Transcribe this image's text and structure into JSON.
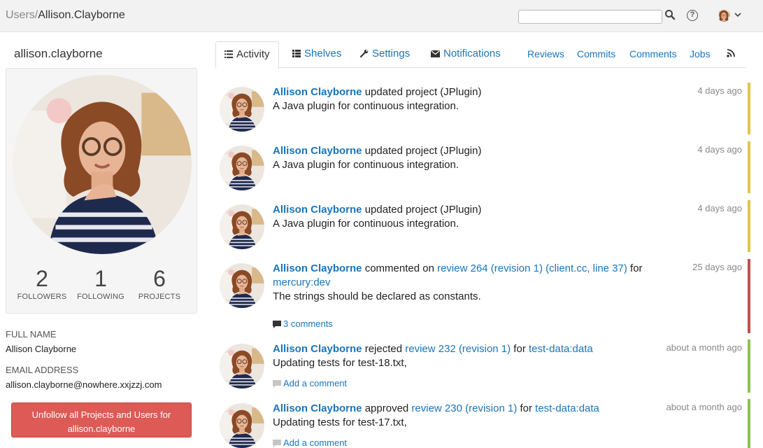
{
  "breadcrumb": {
    "root": "Users/",
    "current": "Allison.Clayborne"
  },
  "search": {
    "value": "",
    "placeholder": ""
  },
  "header": {
    "help_label": "?"
  },
  "profile": {
    "username": "allison.clayborne",
    "stats": [
      {
        "value": "2",
        "label": "FOLLOWERS"
      },
      {
        "value": "1",
        "label": "FOLLOWING"
      },
      {
        "value": "6",
        "label": "PROJECTS"
      }
    ],
    "full_name_label": "FULL NAME",
    "full_name": "Allison Clayborne",
    "email_label": "EMAIL ADDRESS",
    "email": "allison.clayborne@nowhere.xxjzzj.com",
    "unfollow_line1": "Unfollow all Projects and Users for",
    "unfollow_line2": "allison.clayborne"
  },
  "tabs": {
    "activity": "Activity",
    "shelves": "Shelves",
    "settings": "Settings",
    "notifications": "Notifications",
    "reviews": "Reviews",
    "commits": "Commits",
    "comments": "Comments",
    "jobs": "Jobs"
  },
  "colors": {
    "yellow": "#dfc64a",
    "red": "#c0504d",
    "green": "#8cc152",
    "link": "#1a75bb"
  },
  "feed": [
    {
      "actor": "Allison Clayborne",
      "verb": " updated project (JPlugin)",
      "desc": "A Java plugin for continuous integration.",
      "time": "4 days ago"
    },
    {
      "actor": "Allison Clayborne",
      "verb": " updated project (JPlugin)",
      "desc": "A Java plugin for continuous integration.",
      "time": "4 days ago"
    },
    {
      "actor": "Allison Clayborne",
      "verb": " updated project (JPlugin)",
      "desc": "A Java plugin for continuous integration.",
      "time": "4 days ago"
    },
    {
      "actor": "Allison Clayborne",
      "verb": " commented on ",
      "link": "review 264 (revision 1) (client.cc, line 37)",
      "for": " for",
      "target": "mercury:dev",
      "desc": "The strings should be declared as constants.",
      "comments": "3 comments",
      "time": "25 days ago"
    },
    {
      "actor": "Allison Clayborne",
      "verb": " rejected ",
      "link": "review 232 (revision 1)",
      "for": " for ",
      "target": "test-data:data",
      "desc": "Updating tests for test-18.txt,",
      "comments": "Add a comment",
      "time": "about a month ago"
    },
    {
      "actor": "Allison Clayborne",
      "verb": " approved ",
      "link": "review 230 (revision 1)",
      "for": " for ",
      "target": "test-data:data",
      "desc": "Updating tests for test-17.txt,",
      "comments": "Add a comment",
      "time": "about a month ago"
    }
  ]
}
